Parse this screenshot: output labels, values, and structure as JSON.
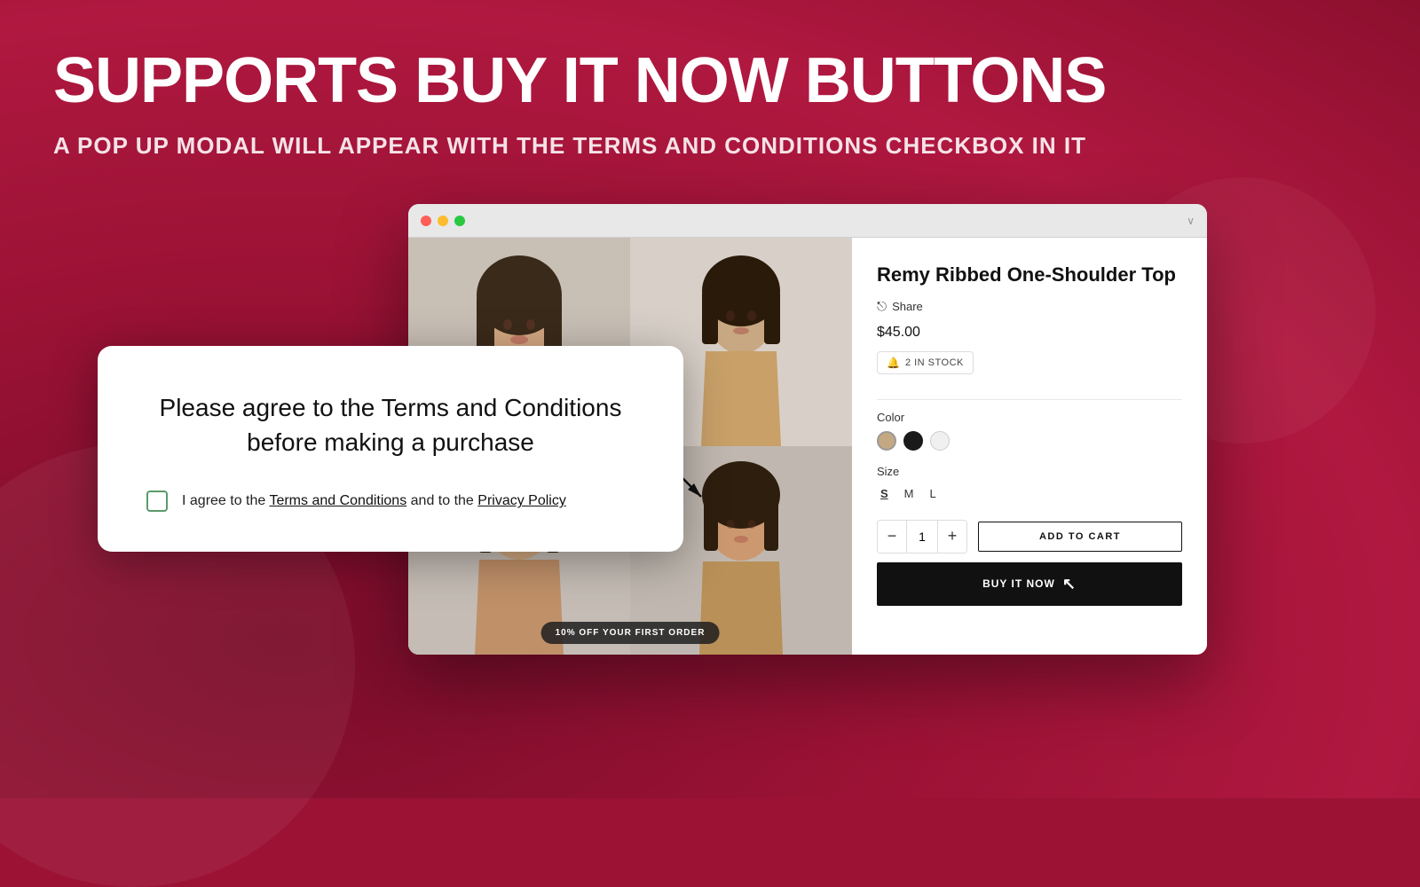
{
  "page": {
    "background_color": "#9b1235"
  },
  "headline": "SUPPORTS BUY IT NOW BUTTONS",
  "subheadline": "A POP UP MODAL WILL APPEAR WITH THE TERMS AND CONDITIONS CHECKBOX IN IT",
  "browser": {
    "dots": [
      "red",
      "yellow",
      "green"
    ]
  },
  "product": {
    "title": "Remy Ribbed One-Shoulder Top",
    "share_label": "Share",
    "price": "$45.00",
    "stock": "2 IN STOCK",
    "color_label": "Color",
    "size_label": "Size",
    "sizes": [
      "S",
      "M",
      "L"
    ],
    "quantity": "1",
    "add_to_cart": "ADD TO CART",
    "buy_now": "BUY IT NOW"
  },
  "promo": {
    "text": "10% OFF YOUR FIRST ORDER"
  },
  "modal": {
    "message": "Please agree to the Terms and Conditions before making a purchase",
    "checkbox_text_prefix": "I agree to the ",
    "terms_link": "Terms and Conditions",
    "checkbox_text_middle": " and to the ",
    "privacy_link": "Privacy Policy"
  }
}
